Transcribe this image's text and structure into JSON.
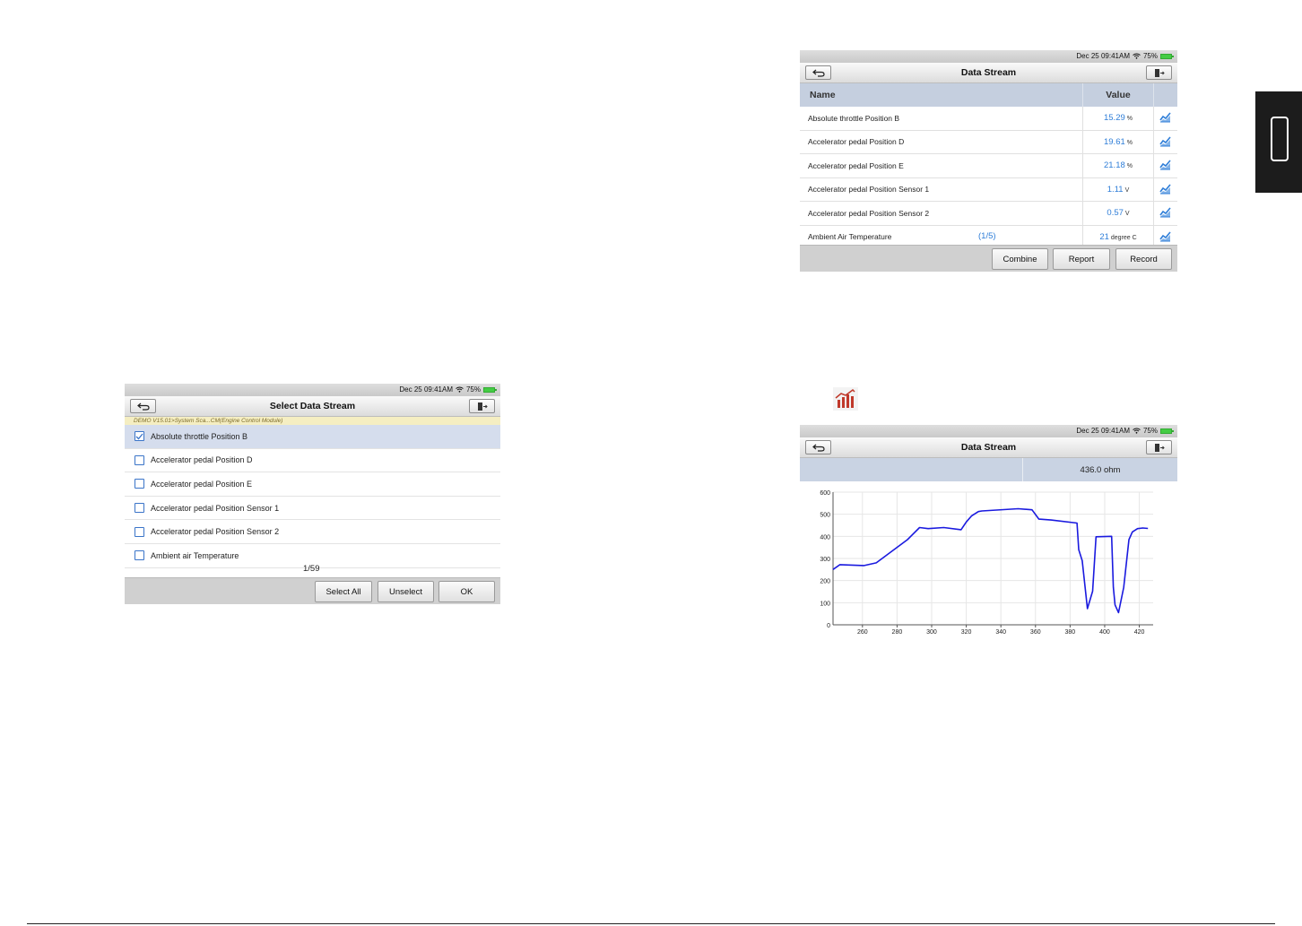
{
  "select_screen": {
    "status": {
      "datetime": "Dec 25 09:41AM",
      "battery": "75%"
    },
    "title": "Select Data Stream",
    "breadcrumb": "DEMO V15.01>System Sca...CM(Engine Control Module)",
    "items": [
      {
        "label": "Absolute throttle Position B",
        "checked": true
      },
      {
        "label": "Accelerator pedal Position D",
        "checked": false
      },
      {
        "label": "Accelerator pedal Position E",
        "checked": false
      },
      {
        "label": "Accelerator pedal Position Sensor 1",
        "checked": false
      },
      {
        "label": "Accelerator pedal Position Sensor 2",
        "checked": false
      },
      {
        "label": "Ambient air Temperature",
        "checked": false
      }
    ],
    "page_indicator": "1/59",
    "buttons": {
      "select_all": "Select All",
      "unselect": "Unselect",
      "ok": "OK"
    }
  },
  "data_screen": {
    "status": {
      "datetime": "Dec 25 09:41AM",
      "battery": "75%"
    },
    "title": "Data Stream",
    "columns": {
      "name": "Name",
      "value": "Value"
    },
    "rows": [
      {
        "name": "Absolute throttle Position B",
        "value": "15.29",
        "unit": "%"
      },
      {
        "name": "Accelerator pedal Position D",
        "value": "19.61",
        "unit": "%"
      },
      {
        "name": "Accelerator pedal Position E",
        "value": "21.18",
        "unit": "%"
      },
      {
        "name": "Accelerator pedal Position Sensor 1",
        "value": "1.11",
        "unit": "V"
      },
      {
        "name": "Accelerator pedal Position Sensor 2",
        "value": "0.57",
        "unit": "V"
      },
      {
        "name": "Ambient Air Temperature",
        "value": "21",
        "unit": "degree C"
      }
    ],
    "page_indicator": "(1/5)",
    "buttons": {
      "combine": "Combine",
      "report": "Report",
      "record": "Record"
    }
  },
  "graph_screen": {
    "status": {
      "datetime": "Dec 25 09:41AM",
      "battery": "75%"
    },
    "title": "Data Stream",
    "current_value": "436.0 ohm",
    "chart_data": {
      "type": "line",
      "x_ticks": [
        "260",
        "280",
        "300",
        "320",
        "340",
        "360",
        "380",
        "400",
        "420"
      ],
      "y_ticks": [
        "0",
        "100",
        "200",
        "300",
        "400",
        "500",
        "600"
      ],
      "xlim": [
        243,
        428
      ],
      "ylim": [
        0,
        600
      ],
      "grid": true,
      "line_color": "#1a1adf",
      "series": [
        {
          "x": [
            243,
            247,
            261,
            268,
            286,
            293,
            298,
            307,
            317,
            320,
            323,
            327,
            329,
            350,
            358,
            362,
            369,
            384,
            385,
            387,
            390,
            393,
            395,
            404,
            405,
            406,
            408,
            411,
            414,
            416,
            419,
            422,
            425
          ],
          "y": [
            250,
            272,
            268,
            280,
            385,
            440,
            435,
            440,
            430,
            465,
            492,
            512,
            515,
            525,
            520,
            478,
            474,
            460,
            340,
            290,
            73,
            152,
            398,
            400,
            170,
            90,
            55,
            170,
            385,
            420,
            435,
            438,
            436
          ]
        }
      ]
    }
  },
  "colors": {
    "value_blue": "#2f7ed8",
    "selected_row": "#d5dded",
    "header_blue": "#c5cfdf",
    "graph_line": "#1a1adf",
    "breadcrumb_bg": "#f5eec2"
  },
  "icons": {
    "back": "back-arrow-icon",
    "exit": "exit-icon",
    "graph": "line-graph-icon",
    "bar_chart": "bar-chart-icon"
  }
}
